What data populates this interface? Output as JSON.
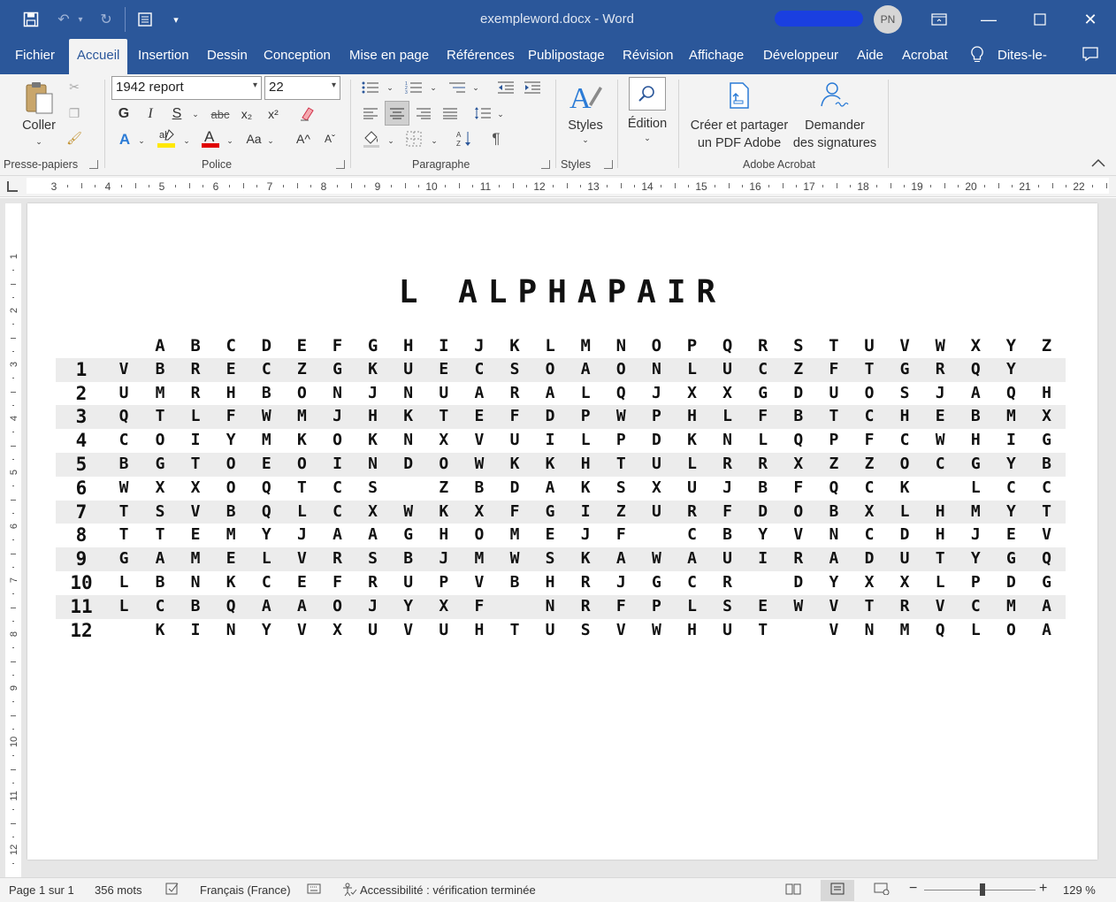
{
  "titlebar": {
    "title": "exempleword.docx  -  Word",
    "avatar_initials": "PN",
    "icons": [
      "save-icon",
      "undo-icon",
      "redo-icon",
      "form-icon",
      "customize-icon"
    ],
    "user_mark_color": "#1a3fe0"
  },
  "tabs": [
    {
      "label": "Fichier"
    },
    {
      "label": "Accueil"
    },
    {
      "label": "Insertion"
    },
    {
      "label": "Dessin"
    },
    {
      "label": "Conception"
    },
    {
      "label": "Mise en page"
    },
    {
      "label": "Références"
    },
    {
      "label": "Publipostage"
    },
    {
      "label": "Révision"
    },
    {
      "label": "Affichage"
    },
    {
      "label": "Développeur"
    },
    {
      "label": "Aide"
    },
    {
      "label": "Acrobat"
    },
    {
      "label": "Dites-le-"
    }
  ],
  "ribbon": {
    "paste_label": "Coller",
    "font_name": "1942 report",
    "font_size": "22",
    "styles_label": "Styles",
    "edition_label": "Édition",
    "pdf_label_1": "Créer et partager",
    "pdf_label_2": "un PDF Adobe",
    "sign_label_1": "Demander",
    "sign_label_2": "des signatures",
    "groups": {
      "clipboard": "Presse-papiers",
      "font": "Police",
      "paragraph": "Paragraphe",
      "styles": "Styles",
      "adobe": "Adobe Acrobat"
    },
    "font_buttons": {
      "bold": "G",
      "italic": "I",
      "underline": "S",
      "strike": "abc",
      "sub": "x₂",
      "sup": "x²",
      "case": "Aa",
      "grow": "A^",
      "shrink": "Aˇ"
    },
    "accent_color": "#2b579a",
    "font_color_bar": "#e00000",
    "highlight_bar": "#ffe800"
  },
  "ruler": {
    "numbers": [
      "3",
      "4",
      "5",
      "6",
      "7",
      "8",
      "9",
      "10",
      "11",
      "12",
      "13",
      "14",
      "15",
      "16",
      "17",
      "18",
      "19",
      "20",
      "21",
      "22"
    ]
  },
  "vruler": {
    "numbers": [
      "1",
      "2",
      "3",
      "4",
      "5",
      "6",
      "7",
      "8",
      "9",
      "10",
      "11",
      "12"
    ]
  },
  "document": {
    "title": "L ALPHAPAIR",
    "columns": [
      "A",
      "B",
      "C",
      "D",
      "E",
      "F",
      "G",
      "H",
      "I",
      "J",
      "K",
      "L",
      "M",
      "N",
      "O",
      "P",
      "Q",
      "R",
      "S",
      "T",
      "U",
      "V",
      "W",
      "X",
      "Y",
      "Z"
    ],
    "rows": [
      {
        "num": "1",
        "cells": [
          "V",
          "B",
          "R",
          "E",
          "C",
          "Z",
          "G",
          "K",
          "U",
          "E",
          "C",
          "S",
          "O",
          "A",
          "O",
          "N",
          "L",
          "U",
          "C",
          "Z",
          "F",
          "T",
          "G",
          "R",
          "Q",
          "Y",
          ""
        ]
      },
      {
        "num": "2",
        "cells": [
          "U",
          "M",
          "R",
          "H",
          "B",
          "O",
          "N",
          "J",
          "N",
          "U",
          "A",
          "R",
          "A",
          "L",
          "Q",
          "J",
          "X",
          "X",
          "G",
          "D",
          "U",
          "O",
          "S",
          "J",
          "A",
          "Q",
          "H"
        ]
      },
      {
        "num": "3",
        "cells": [
          "Q",
          "T",
          "L",
          "F",
          "W",
          "M",
          "J",
          "H",
          "K",
          "T",
          "E",
          "F",
          "D",
          "P",
          "W",
          "P",
          "H",
          "L",
          "F",
          "B",
          "T",
          "C",
          "H",
          "E",
          "B",
          "M",
          "X"
        ]
      },
      {
        "num": "4",
        "cells": [
          "C",
          "O",
          "I",
          "Y",
          "M",
          "K",
          "O",
          "K",
          "N",
          "X",
          "V",
          "U",
          "I",
          "L",
          "P",
          "D",
          "K",
          "N",
          "L",
          "Q",
          "P",
          "F",
          "C",
          "W",
          "H",
          "I",
          "G"
        ]
      },
      {
        "num": "5",
        "cells": [
          "B",
          "G",
          "T",
          "O",
          "E",
          "O",
          "I",
          "N",
          "D",
          "O",
          "W",
          "K",
          "K",
          "H",
          "T",
          "U",
          "L",
          "R",
          "R",
          "X",
          "Z",
          "Z",
          "O",
          "C",
          "G",
          "Y",
          "B"
        ]
      },
      {
        "num": "6",
        "cells": [
          "W",
          "X",
          "X",
          "O",
          "Q",
          "T",
          "C",
          "S",
          "",
          "Z",
          "B",
          "D",
          "A",
          "K",
          "S",
          "X",
          "U",
          "J",
          "B",
          "F",
          "Q",
          "C",
          "K",
          "",
          "L",
          "C",
          "C"
        ]
      },
      {
        "num": "7",
        "cells": [
          "T",
          "S",
          "V",
          "B",
          "Q",
          "L",
          "C",
          "X",
          "W",
          "K",
          "X",
          "F",
          "G",
          "I",
          "Z",
          "U",
          "R",
          "F",
          "D",
          "O",
          "B",
          "X",
          "L",
          "H",
          "M",
          "Y",
          "T"
        ]
      },
      {
        "num": "8",
        "cells": [
          "T",
          "T",
          "E",
          "M",
          "Y",
          "J",
          "A",
          "A",
          "G",
          "H",
          "O",
          "M",
          "E",
          "J",
          "F",
          "",
          "C",
          "B",
          "Y",
          "V",
          "N",
          "C",
          "D",
          "H",
          "J",
          "E",
          "V"
        ]
      },
      {
        "num": "9",
        "cells": [
          "G",
          "A",
          "M",
          "E",
          "L",
          "V",
          "R",
          "S",
          "B",
          "J",
          "M",
          "W",
          "S",
          "K",
          "A",
          "W",
          "A",
          "U",
          "I",
          "R",
          "A",
          "D",
          "U",
          "T",
          "Y",
          "G",
          "Q"
        ]
      },
      {
        "num": "10",
        "cells": [
          "L",
          "B",
          "N",
          "K",
          "C",
          "E",
          "F",
          "R",
          "U",
          "P",
          "V",
          "B",
          "H",
          "R",
          "J",
          "G",
          "C",
          "R",
          "",
          "D",
          "Y",
          "X",
          "X",
          "L",
          "P",
          "D",
          "G"
        ]
      },
      {
        "num": "11",
        "cells": [
          "L",
          "C",
          "B",
          "Q",
          "A",
          "A",
          "O",
          "J",
          "Y",
          "X",
          "F",
          "",
          "N",
          "R",
          "F",
          "P",
          "L",
          "S",
          "E",
          "W",
          "V",
          "T",
          "R",
          "V",
          "C",
          "M",
          "A"
        ]
      },
      {
        "num": "12",
        "cells": [
          "",
          "K",
          "I",
          "N",
          "Y",
          "V",
          "X",
          "U",
          "V",
          "U",
          "H",
          "T",
          "U",
          "S",
          "V",
          "W",
          "H",
          "U",
          "T",
          "",
          "V",
          "N",
          "M",
          "Q",
          "L",
          "O",
          "A"
        ]
      }
    ]
  },
  "status": {
    "page": "Page 1 sur 1",
    "words": "356 mots",
    "language": "Français (France)",
    "accessibility": "Accessibilité : vérification terminée",
    "zoom_minus": "−",
    "zoom_plus": "+",
    "zoom": "129 %"
  }
}
